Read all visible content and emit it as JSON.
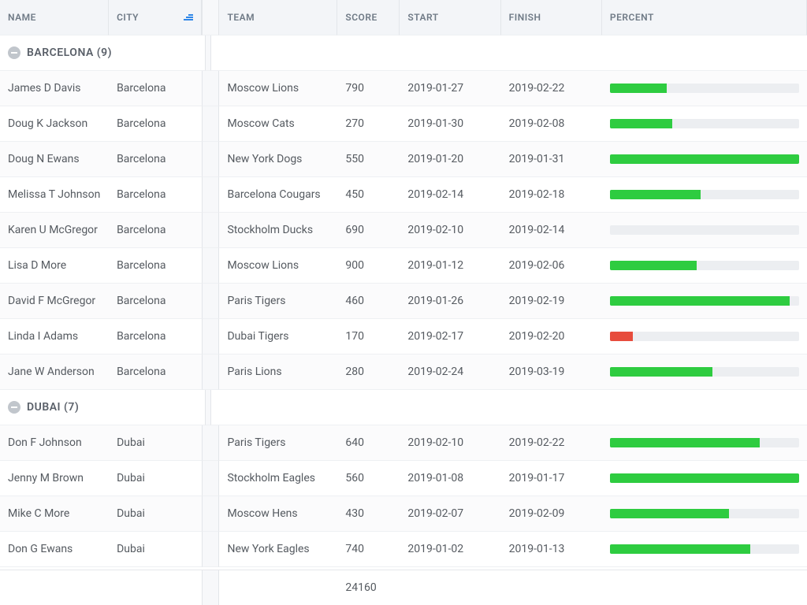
{
  "columns": {
    "name": "Name",
    "city": "City",
    "team": "Team",
    "score": "Score",
    "start": "Start",
    "finish": "Finish",
    "percent": "Percent"
  },
  "groups": [
    {
      "label": "BARCELONA (9)",
      "rows": [
        {
          "name": "James D Davis",
          "city": "Barcelona",
          "team": "Moscow Lions",
          "score": "790",
          "start": "2019-01-27",
          "finish": "2019-02-22",
          "pct": 30,
          "color": "green"
        },
        {
          "name": "Doug K Jackson",
          "city": "Barcelona",
          "team": "Moscow Cats",
          "score": "270",
          "start": "2019-01-30",
          "finish": "2019-02-08",
          "pct": 33,
          "color": "green"
        },
        {
          "name": "Doug N Ewans",
          "city": "Barcelona",
          "team": "New York Dogs",
          "score": "550",
          "start": "2019-01-20",
          "finish": "2019-01-31",
          "pct": 100,
          "color": "green"
        },
        {
          "name": "Melissa T Johnson",
          "city": "Barcelona",
          "team": "Barcelona Cougars",
          "score": "450",
          "start": "2019-02-14",
          "finish": "2019-02-18",
          "pct": 48,
          "color": "green"
        },
        {
          "name": "Karen U McGregor",
          "city": "Barcelona",
          "team": "Stockholm Ducks",
          "score": "690",
          "start": "2019-02-10",
          "finish": "2019-02-14",
          "pct": 0,
          "color": "green"
        },
        {
          "name": "Lisa D More",
          "city": "Barcelona",
          "team": "Moscow Lions",
          "score": "900",
          "start": "2019-01-12",
          "finish": "2019-02-06",
          "pct": 46,
          "color": "green"
        },
        {
          "name": "David F McGregor",
          "city": "Barcelona",
          "team": "Paris Tigers",
          "score": "460",
          "start": "2019-01-26",
          "finish": "2019-02-19",
          "pct": 95,
          "color": "green"
        },
        {
          "name": "Linda I Adams",
          "city": "Barcelona",
          "team": "Dubai Tigers",
          "score": "170",
          "start": "2019-02-17",
          "finish": "2019-02-20",
          "pct": 12,
          "color": "red"
        },
        {
          "name": "Jane W Anderson",
          "city": "Barcelona",
          "team": "Paris Lions",
          "score": "280",
          "start": "2019-02-24",
          "finish": "2019-03-19",
          "pct": 54,
          "color": "green"
        }
      ]
    },
    {
      "label": "DUBAI (7)",
      "rows": [
        {
          "name": "Don F Johnson",
          "city": "Dubai",
          "team": "Paris Tigers",
          "score": "640",
          "start": "2019-02-10",
          "finish": "2019-02-22",
          "pct": 79,
          "color": "green"
        },
        {
          "name": "Jenny M Brown",
          "city": "Dubai",
          "team": "Stockholm Eagles",
          "score": "560",
          "start": "2019-01-08",
          "finish": "2019-01-17",
          "pct": 100,
          "color": "green"
        },
        {
          "name": "Mike C More",
          "city": "Dubai",
          "team": "Moscow Hens",
          "score": "430",
          "start": "2019-02-07",
          "finish": "2019-02-09",
          "pct": 63,
          "color": "green"
        },
        {
          "name": "Don G Ewans",
          "city": "Dubai",
          "team": "New York Eagles",
          "score": "740",
          "start": "2019-01-02",
          "finish": "2019-01-13",
          "pct": 74,
          "color": "green"
        }
      ]
    }
  ],
  "footer": {
    "score_total": "24160"
  }
}
